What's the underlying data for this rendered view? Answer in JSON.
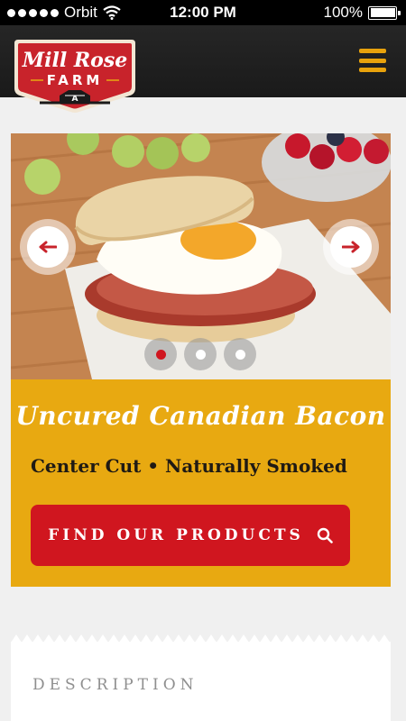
{
  "status_bar": {
    "carrier": "Orbit",
    "time": "12:00 PM",
    "battery": "100%"
  },
  "header": {
    "logo": {
      "line1": "Mill Rose",
      "line2": "FARM",
      "emblem": "A"
    },
    "menu_icon": "hamburger-menu-icon"
  },
  "carousel": {
    "left_arrow_icon": "arrow-left-icon",
    "right_arrow_icon": "arrow-right-icon",
    "slide_count": 3,
    "active_slide": 1
  },
  "promo": {
    "title": "Uncured Canadian Bacon",
    "subtitle": "Center Cut • Naturally Smoked",
    "button_label": "FIND OUR PRODUCTS",
    "button_icon": "search-icon"
  },
  "description": {
    "label": "DESCRIPTION"
  },
  "colors": {
    "header_bg": "#1f1f1f",
    "accent_gold": "#e8a911",
    "accent_red": "#d0161f",
    "page_bg": "#f0f0f0"
  }
}
